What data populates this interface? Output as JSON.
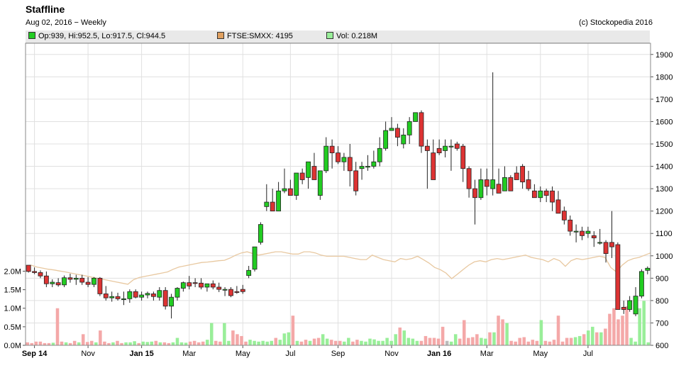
{
  "header": {
    "title": "Staffline",
    "subtitle": "Aug 02, 2016 − Weekly",
    "copyright": "(c) Stockopedia 2016"
  },
  "legend": [
    {
      "label": "Op:939, Hi:952.5, Lo:917.5, Cl:944.5",
      "color": "#22cc22"
    },
    {
      "label": "FTSE:SMXX: 4195",
      "color": "#e0a060"
    },
    {
      "label": "Vol: 0.218M",
      "color": "#99ee99"
    }
  ],
  "chart_data": {
    "type": "candlestick",
    "y_axis": {
      "position": "right",
      "min": 600,
      "max": 1950,
      "ticks": [
        600,
        700,
        800,
        900,
        1000,
        1100,
        1200,
        1300,
        1400,
        1500,
        1600,
        1700,
        1800,
        1900
      ]
    },
    "volume_axis": {
      "position": "left",
      "unit": "M",
      "min": 0,
      "max": 2.2,
      "ticks": [
        0,
        0.5,
        1.0,
        1.5,
        2.0
      ],
      "tick_labels": [
        "0.0M",
        "0.5M",
        "1.0M",
        "1.5M",
        "2.0M"
      ]
    },
    "x_axis": {
      "labels": [
        "Sep 14",
        "Nov",
        "Jan 15",
        "Mar",
        "May",
        "Jul",
        "Sep",
        "Nov",
        "Jan 16",
        "Mar",
        "May",
        "Jul"
      ],
      "bold_labels": [
        "Sep 14",
        "Jan 15",
        "Jan 16"
      ],
      "label_week_index": [
        1,
        10,
        19,
        27,
        36,
        44,
        52,
        61,
        69,
        77,
        86,
        94
      ]
    },
    "grid": true,
    "colors": {
      "up": "#22cc22",
      "down": "#dd3333",
      "index_line": "#e8c8a0",
      "volume_up": "#99ee99",
      "volume_down": "#f4a8a8",
      "volume_flat": "#bbbbbb"
    },
    "series": [
      {
        "name": "Staffline",
        "type": "ohlc",
        "ohlc": [
          [
            958,
            958,
            925,
            930
          ],
          [
            930,
            948,
            918,
            925
          ],
          [
            925,
            935,
            900,
            910
          ],
          [
            910,
            930,
            860,
            875
          ],
          [
            875,
            895,
            860,
            882
          ],
          [
            880,
            900,
            862,
            870
          ],
          [
            870,
            912,
            860,
            902
          ],
          [
            902,
            920,
            880,
            895
          ],
          [
            895,
            915,
            870,
            900
          ],
          [
            900,
            915,
            870,
            882
          ],
          [
            882,
            905,
            860,
            872
          ],
          [
            872,
            905,
            860,
            900
          ],
          [
            900,
            905,
            820,
            830
          ],
          [
            830,
            865,
            800,
            812
          ],
          [
            812,
            840,
            795,
            818
          ],
          [
            818,
            835,
            800,
            808
          ],
          [
            808,
            840,
            780,
            808
          ],
          [
            808,
            850,
            790,
            840
          ],
          [
            840,
            850,
            810,
            815
          ],
          [
            815,
            840,
            800,
            825
          ],
          [
            825,
            840,
            810,
            832
          ],
          [
            830,
            840,
            800,
            818
          ],
          [
            815,
            860,
            800,
            845
          ],
          [
            845,
            860,
            760,
            775
          ],
          [
            775,
            830,
            720,
            815
          ],
          [
            815,
            860,
            800,
            855
          ],
          [
            855,
            885,
            840,
            880
          ],
          [
            880,
            910,
            850,
            865
          ],
          [
            880,
            900,
            860,
            878
          ],
          [
            878,
            900,
            850,
            860
          ],
          [
            860,
            875,
            840,
            875
          ],
          [
            875,
            890,
            850,
            860
          ],
          [
            860,
            880,
            838,
            850
          ],
          [
            850,
            860,
            820,
            850
          ],
          [
            850,
            860,
            815,
            822
          ],
          [
            840,
            865,
            830,
            836
          ],
          [
            850,
            870,
            830,
            840
          ],
          [
            912,
            955,
            900,
            935
          ],
          [
            940,
            1040,
            930,
            1040
          ],
          [
            1060,
            1150,
            1050,
            1140
          ],
          [
            1220,
            1320,
            1200,
            1240
          ],
          [
            1240,
            1300,
            1200,
            1200
          ],
          [
            1200,
            1330,
            1200,
            1290
          ],
          [
            1290,
            1390,
            1280,
            1300
          ],
          [
            1300,
            1340,
            1270,
            1270
          ],
          [
            1270,
            1360,
            1250,
            1370
          ],
          [
            1370,
            1390,
            1320,
            1340
          ],
          [
            1350,
            1400,
            1300,
            1420
          ],
          [
            1400,
            1460,
            1350,
            1340
          ],
          [
            1270,
            1380,
            1250,
            1380
          ],
          [
            1380,
            1530,
            1370,
            1490
          ],
          [
            1490,
            1520,
            1390,
            1460
          ],
          [
            1460,
            1490,
            1410,
            1420
          ],
          [
            1420,
            1460,
            1380,
            1440
          ],
          [
            1440,
            1500,
            1310,
            1380
          ],
          [
            1380,
            1420,
            1270,
            1290
          ],
          [
            1390,
            1420,
            1340,
            1400
          ],
          [
            1400,
            1450,
            1380,
            1400
          ],
          [
            1400,
            1470,
            1390,
            1420
          ],
          [
            1420,
            1530,
            1400,
            1480
          ],
          [
            1480,
            1600,
            1470,
            1560
          ],
          [
            1560,
            1620,
            1560,
            1570
          ],
          [
            1570,
            1590,
            1490,
            1530
          ],
          [
            1500,
            1570,
            1480,
            1540
          ],
          [
            1540,
            1620,
            1500,
            1600
          ],
          [
            1600,
            1620,
            1600,
            1640
          ],
          [
            1640,
            1650,
            1460,
            1490
          ],
          [
            1490,
            1520,
            1300,
            1470
          ],
          [
            1460,
            1520,
            1410,
            1340
          ],
          [
            1480,
            1520,
            1450,
            1460
          ],
          [
            1470,
            1520,
            1440,
            1490
          ],
          [
            1490,
            1520,
            1380,
            1490
          ],
          [
            1500,
            1510,
            1470,
            1480
          ],
          [
            1490,
            1500,
            1330,
            1390
          ],
          [
            1390,
            1400,
            1260,
            1300
          ],
          [
            1300,
            1340,
            1140,
            1260
          ],
          [
            1260,
            1390,
            1250,
            1340
          ],
          [
            1340,
            1390,
            1270,
            1310
          ],
          [
            1300,
            1820,
            1270,
            1340
          ],
          [
            1320,
            1390,
            1280,
            1280
          ],
          [
            1290,
            1400,
            1290,
            1350
          ],
          [
            1350,
            1360,
            1300,
            1290
          ],
          [
            1370,
            1400,
            1360,
            1340
          ],
          [
            1400,
            1410,
            1300,
            1330
          ],
          [
            1340,
            1380,
            1290,
            1300
          ],
          [
            1290,
            1320,
            1270,
            1260
          ],
          [
            1260,
            1310,
            1240,
            1290
          ],
          [
            1290,
            1300,
            1240,
            1270
          ],
          [
            1290,
            1310,
            1200,
            1240
          ],
          [
            1250,
            1290,
            1220,
            1190
          ],
          [
            1200,
            1220,
            1140,
            1160
          ],
          [
            1160,
            1180,
            1090,
            1110
          ],
          [
            1110,
            1140,
            1060,
            1110
          ],
          [
            1110,
            1130,
            1070,
            1090
          ],
          [
            1100,
            1130,
            1080,
            1110
          ],
          [
            1090,
            1110,
            1040,
            1080
          ],
          [
            1060,
            1120,
            1050,
            1060
          ],
          [
            1060,
            1070,
            970,
            1010
          ],
          [
            1060,
            1200,
            990,
            1040
          ],
          [
            1050,
            1060,
            800,
            760
          ],
          [
            770,
            800,
            740,
            760
          ],
          [
            760,
            820,
            750,
            800
          ],
          [
            740,
            860,
            730,
            820
          ],
          [
            820,
            940,
            810,
            930
          ],
          [
            935,
            952.5,
            917.5,
            944.5
          ]
        ]
      },
      {
        "name": "FTSE:SMXX",
        "type": "line",
        "values": [
          955,
          958,
          950,
          945,
          940,
          937,
          932,
          928,
          923,
          918,
          913,
          908,
          903,
          898,
          893,
          888,
          883,
          878,
          873,
          893,
          903,
          908,
          913,
          918,
          923,
          928,
          940,
          950,
          955,
          960,
          965,
          970,
          972,
          975,
          978,
          980,
          990,
          1003,
          1013,
          1018,
          1010,
          1003,
          1008,
          1013,
          1018,
          1018,
          1013,
          1008,
          1008,
          1018,
          1018,
          1013,
          1003,
          998,
          998,
          998,
          998,
          993,
          988,
          983,
          983,
          1003,
          993,
          983,
          978,
          973,
          988,
          983,
          988,
          998,
          983,
          968,
          948,
          938,
          923,
          898,
          918,
          938,
          958,
          973,
          978,
          973,
          983,
          988,
          983,
          988,
          993,
          998,
          1003,
          993,
          988,
          983,
          973,
          988,
          978,
          953,
          978,
          988,
          983,
          988,
          993,
          998,
          993,
          948,
          928,
          958,
          978,
          988,
          993,
          1003,
          1013
        ]
      },
      {
        "name": "Vol",
        "type": "volume",
        "values": [
          0.08,
          0.06,
          0.1,
          0.1,
          0.06,
          0.06,
          0.07,
          1.0,
          0.1,
          0.08,
          0.06,
          0.12,
          0.08,
          0.3,
          0.09,
          0.12,
          0.08,
          0.4,
          0.1,
          0.06,
          0.08,
          0.12,
          0.06,
          0.08,
          0.08,
          0.11,
          0.06,
          0.1,
          0.09,
          0.1,
          0.12,
          0.08,
          0.08,
          0.06,
          0.08,
          0.2,
          0.08,
          0.07,
          0.1,
          0.12,
          0.08,
          0.1,
          0.15,
          0.6,
          0.12,
          0.1,
          0.6,
          0.12,
          0.4,
          0.3,
          0.25,
          0.1,
          0.15,
          0.12,
          0.1,
          0.12,
          0.1,
          0.12,
          0.2,
          0.15,
          0.32,
          0.35,
          0.8,
          0.12,
          0.1,
          0.15,
          0.12,
          0.18,
          0.2,
          0.3,
          0.18,
          0.15,
          0.12,
          0.12,
          0.1,
          0.2,
          0.1,
          0.15,
          0.12,
          0.1,
          0.18,
          0.16,
          0.12,
          0.12,
          0.2,
          0.12,
          0.3,
          0.48,
          0.4,
          0.2,
          0.18,
          0.12,
          0.12,
          0.25,
          0.2,
          0.2,
          0.18,
          0.5,
          0.12,
          0.1,
          0.3,
          0.18,
          0.68,
          0.2,
          0.22,
          0.3,
          0.2,
          0.18,
          0.35,
          0.35,
          0.8,
          0.7,
          0.6,
          0.12,
          0.1,
          0.2,
          0.22,
          0.1,
          0.15,
          0.12,
          0.68,
          0.12,
          0.1,
          0.15,
          0.8,
          0.1,
          0.2,
          0.2,
          0.22,
          0.25,
          0.3,
          0.4,
          0.5,
          0.35,
          0.35,
          0.45,
          0.85,
          1.0,
          0.7,
          0.8,
          1.05,
          0.2,
          0.1,
          1.0,
          1.2,
          0.08
        ]
      }
    ]
  }
}
